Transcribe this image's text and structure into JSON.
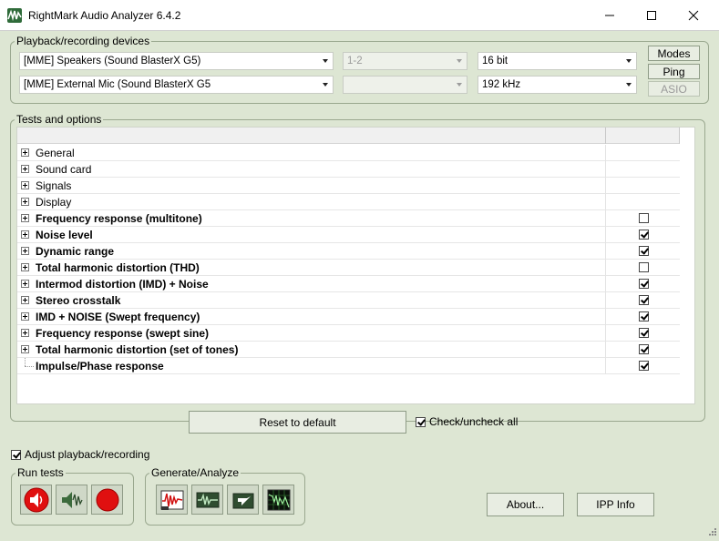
{
  "window": {
    "title": "RightMark Audio Analyzer 6.4.2"
  },
  "devices": {
    "legend": "Playback/recording devices",
    "playback_device": "[MME] Speakers (Sound BlasterX G5)",
    "playback_channels": "1-2",
    "bit_depth": "16 bit",
    "recording_device": "[MME] External Mic (Sound BlasterX G5",
    "recording_channels": "",
    "sample_rate": "192 kHz",
    "modes_label": "Modes",
    "ping_label": "Ping",
    "asio_label": "ASIO"
  },
  "tests": {
    "legend": "Tests and options",
    "rows": [
      {
        "label": "General",
        "bold": false,
        "expandable": true,
        "checkbox": null
      },
      {
        "label": "Sound card",
        "bold": false,
        "expandable": true,
        "checkbox": null
      },
      {
        "label": "Signals",
        "bold": false,
        "expandable": true,
        "checkbox": null
      },
      {
        "label": "Display",
        "bold": false,
        "expandable": true,
        "checkbox": null
      },
      {
        "label": "Frequency response (multitone)",
        "bold": true,
        "expandable": true,
        "checkbox": false
      },
      {
        "label": "Noise level",
        "bold": true,
        "expandable": true,
        "checkbox": true
      },
      {
        "label": "Dynamic range",
        "bold": true,
        "expandable": true,
        "checkbox": true
      },
      {
        "label": "Total harmonic distortion (THD)",
        "bold": true,
        "expandable": true,
        "checkbox": false
      },
      {
        "label": "Intermod distortion (IMD) + Noise",
        "bold": true,
        "expandable": true,
        "checkbox": true
      },
      {
        "label": "Stereo crosstalk",
        "bold": true,
        "expandable": true,
        "checkbox": true
      },
      {
        "label": "IMD + NOISE (Swept frequency)",
        "bold": true,
        "expandable": true,
        "checkbox": true
      },
      {
        "label": "Frequency response (swept sine)",
        "bold": true,
        "expandable": true,
        "checkbox": true
      },
      {
        "label": "Total harmonic distortion (set of tones)",
        "bold": true,
        "expandable": true,
        "checkbox": true
      },
      {
        "label": "Impulse/Phase response",
        "bold": true,
        "expandable": false,
        "checkbox": true
      }
    ],
    "reset_label": "Reset to default",
    "check_all_label": "Check/uncheck all",
    "check_all_checked": true
  },
  "adjust": {
    "label": "Adjust playback/recording",
    "checked": true
  },
  "run_tests": {
    "legend": "Run tests"
  },
  "generate": {
    "legend": "Generate/Analyze"
  },
  "footer": {
    "about_label": "About...",
    "ipp_label": "IPP Info"
  },
  "colors": {
    "background": "#dde6d3",
    "run_red": "#e01010",
    "speaker_green": "#3c6b3c"
  }
}
